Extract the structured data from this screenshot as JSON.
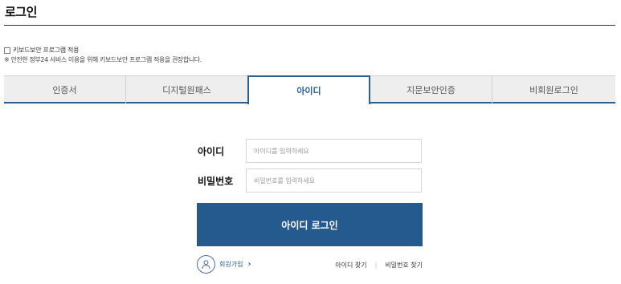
{
  "header": {
    "title": "로그인"
  },
  "keyboard_security": {
    "checkbox_label": "키보드보안 프로그램 적용",
    "notice": "※ 안전한 정부24 서비스 이용을 위해 키보드보안 프로그램 적용을 권장합니다."
  },
  "tabs": [
    {
      "label": "인증서",
      "active": false
    },
    {
      "label": "디지털원패스",
      "active": false
    },
    {
      "label": "아이디",
      "active": true
    },
    {
      "label": "지문보안인증",
      "active": false
    },
    {
      "label": "비회원로그인",
      "active": false
    }
  ],
  "form": {
    "id_label": "아이디",
    "id_placeholder": "아이디를 입력하세요",
    "password_label": "비밀번호",
    "password_placeholder": "비밀번호를 입력하세요",
    "submit_label": "아이디 로그인"
  },
  "footer": {
    "signup_label": "회원가입",
    "signup_chevron": "›",
    "find_id": "아이디 찾기",
    "separator": "|",
    "find_password": "비밀번호 찾기"
  },
  "colors": {
    "accent": "#2b5f91",
    "button": "#255a8f",
    "tab_bg": "#eeeeee"
  },
  "icons": {
    "signup": "person-icon",
    "chevron": "chevron-right-icon"
  }
}
